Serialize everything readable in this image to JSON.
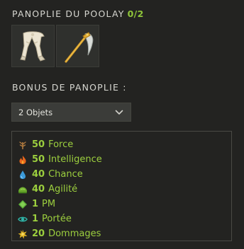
{
  "set": {
    "title": "PANOPLIE DU POOLAY",
    "count": "0/2",
    "items": [
      {
        "name": "poolay-boots-icon"
      },
      {
        "name": "poolay-scythe-icon"
      }
    ]
  },
  "bonus": {
    "header": "BONUS DE PANOPLIE :",
    "selected": "2 Objets",
    "stats": [
      {
        "value": "50",
        "label": "Force",
        "icon": "force-icon",
        "color": "#b07a3e"
      },
      {
        "value": "50",
        "label": "Intelligence",
        "icon": "intelligence-icon",
        "color": "#e06a1f"
      },
      {
        "value": "40",
        "label": "Chance",
        "icon": "chance-icon",
        "color": "#3a9ad8"
      },
      {
        "value": "40",
        "label": "Agilité",
        "icon": "agilite-icon",
        "color": "#6fae2f"
      },
      {
        "value": "1",
        "label": "PM",
        "icon": "pm-icon",
        "color": "#5fb13a"
      },
      {
        "value": "1",
        "label": "Portée",
        "icon": "portee-icon",
        "color": "#2fb3a6"
      },
      {
        "value": "20",
        "label": "Dommages",
        "icon": "dommages-icon",
        "color": "#e0b422"
      }
    ]
  },
  "colors": {
    "background": "#232321",
    "accent_green": "#9ccf3e",
    "count_green": "#8fc63a"
  }
}
